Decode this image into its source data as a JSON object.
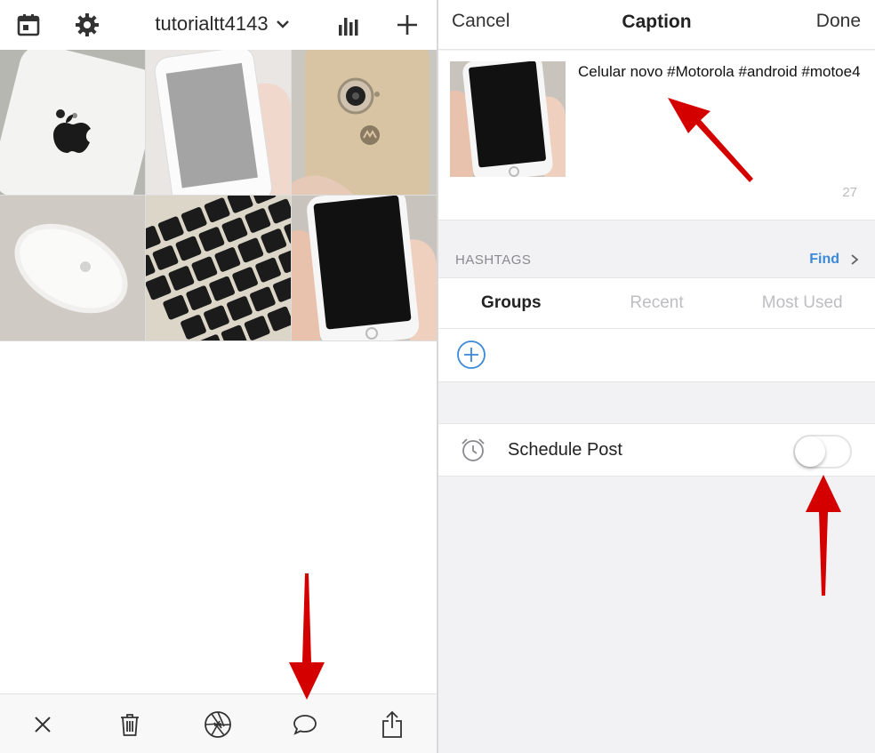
{
  "left": {
    "header": {
      "account_name": "tutorialtt4143",
      "icons": [
        "calendar-icon",
        "gear-icon",
        "chevron-down-icon",
        "bar-chart-icon",
        "plus-icon"
      ]
    },
    "grid": {
      "thumbnails": [
        "white-iphone-back-photo",
        "white-phone-front-photo",
        "gold-moto-phone-back-photo",
        "apple-magic-mouse-photo",
        "laptop-keyboard-photo",
        "white-phone-black-screen-photo"
      ]
    },
    "toolbar": {
      "icons": [
        "close-icon",
        "trash-icon",
        "aperture-icon",
        "comment-icon",
        "share-icon"
      ]
    }
  },
  "right": {
    "header": {
      "cancel_label": "Cancel",
      "title": "Caption",
      "done_label": "Done"
    },
    "caption": {
      "text": "Celular novo #Motorola #android #motoe4",
      "char_count": "27"
    },
    "hashtags": {
      "label": "HASHTAGS",
      "find_label": "Find"
    },
    "tabs": {
      "groups": "Groups",
      "recent": "Recent",
      "most_used": "Most Used",
      "active": "Groups"
    },
    "schedule": {
      "label": "Schedule Post",
      "enabled": false
    }
  },
  "colors": {
    "accent": "#3b89d8",
    "annotation_arrow": "#d40000",
    "panel_bg": "#f2f2f4"
  }
}
